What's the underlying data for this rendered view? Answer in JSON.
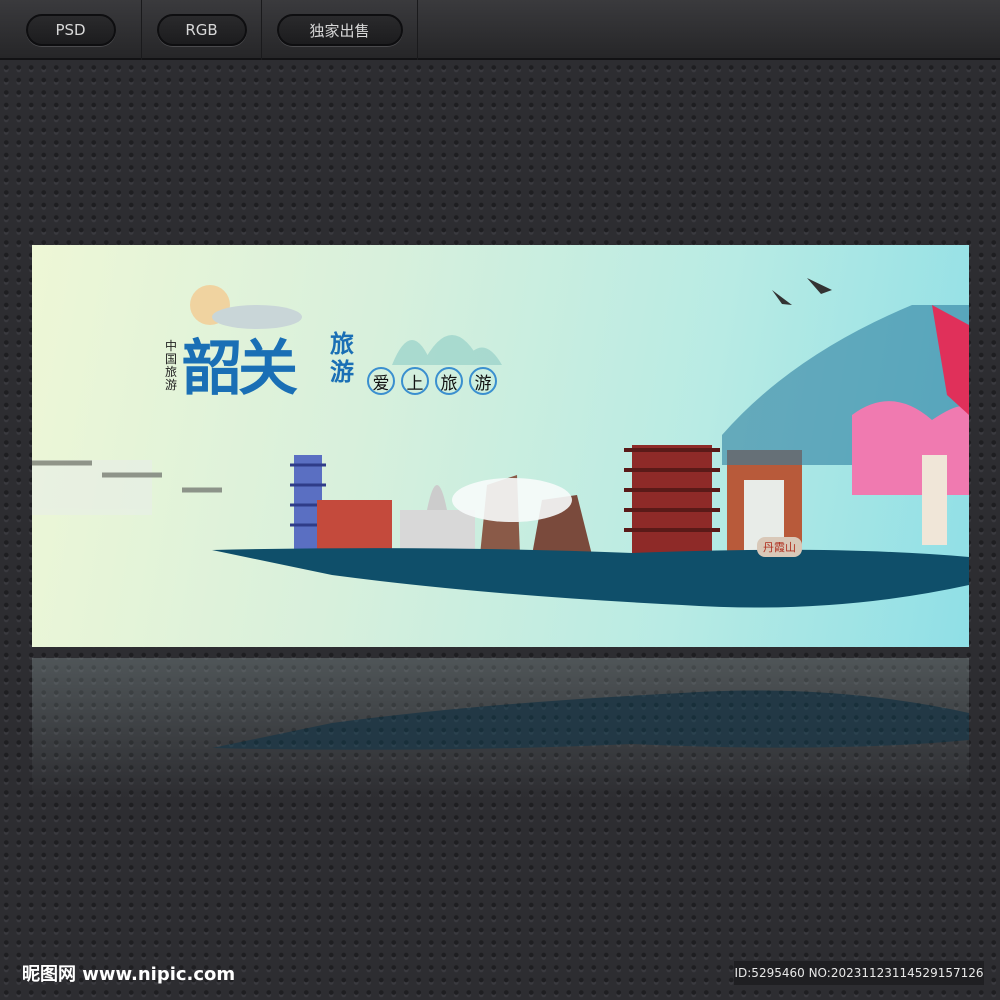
{
  "toolbar": {
    "buttons": [
      {
        "label": "PSD"
      },
      {
        "label": "RGB"
      },
      {
        "label": "独家出售"
      }
    ]
  },
  "banner": {
    "small_vertical": "中国旅游",
    "title": "韶关",
    "sub_title": "旅游",
    "slogan": [
      "爱",
      "上",
      "旅",
      "游"
    ],
    "gate_inscription": "丹霞山"
  },
  "footer": {
    "logo": "昵图网 www.nipic.com",
    "id_text": "ID:5295460 NO:20231123114529157126"
  },
  "colors": {
    "title_blue": "#1a6fb5",
    "accent_red": "#c0392b",
    "ink_teal": "#0f4f6a"
  }
}
